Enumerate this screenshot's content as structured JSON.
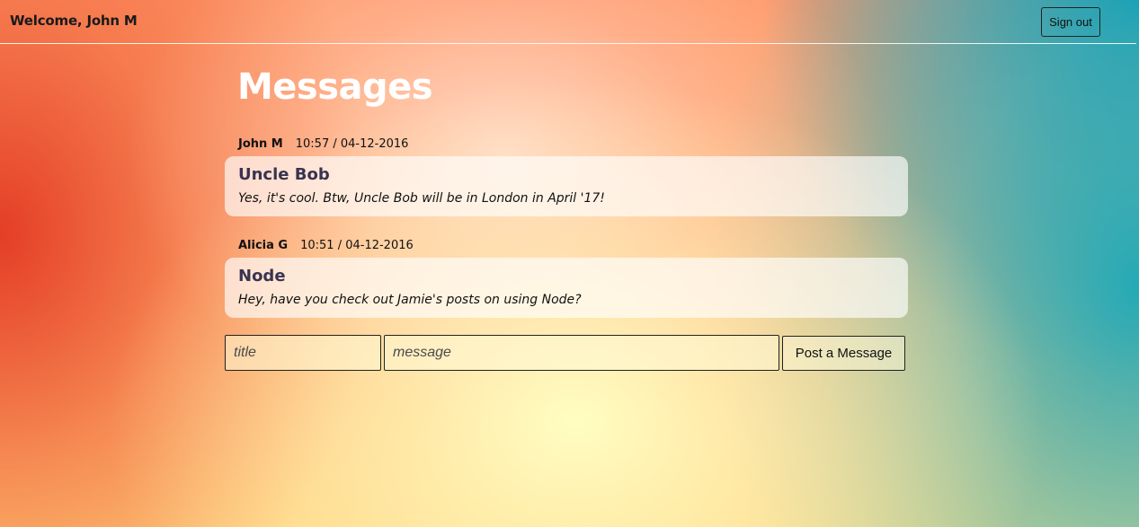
{
  "header": {
    "welcome_text": "Welcome, John M",
    "sign_out_label": "Sign out"
  },
  "main": {
    "title": "Messages",
    "messages": [
      {
        "author": "John M",
        "timestamp": "10:57 / 04-12-2016",
        "title": "Uncle Bob",
        "body": "Yes, it's cool. Btw, Uncle Bob will be in London in April '17!"
      },
      {
        "author": "Alicia G",
        "timestamp": "10:51 / 04-12-2016",
        "title": "Node",
        "body": "Hey, have you check out Jamie's posts on using Node?"
      }
    ]
  },
  "composer": {
    "title_placeholder": "title",
    "title_value": "",
    "message_placeholder": "message",
    "message_value": "",
    "post_label": "Post a Message"
  },
  "colors": {
    "page_title": "#ffffff",
    "card_title": "#3a3350",
    "card_background": "rgba(255,255,255,0.66)",
    "gradient_left": "#e43e26",
    "gradient_center": "#ffffc3",
    "gradient_right": "#008caf"
  }
}
